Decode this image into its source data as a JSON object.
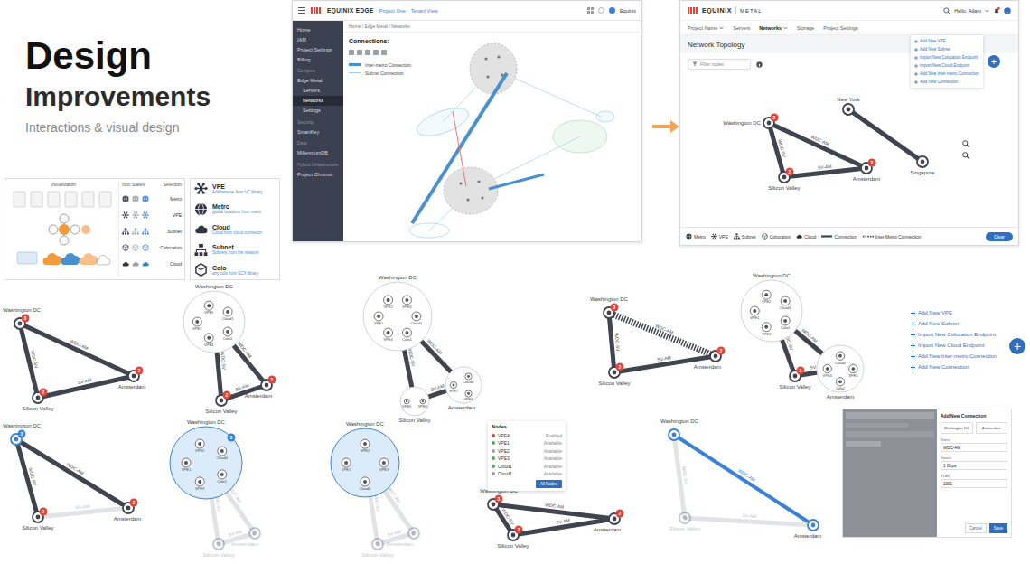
{
  "heading": {
    "title": "Design",
    "subtitle": "Improvements",
    "tagline": "Interactions & visual design"
  },
  "icon_sheet": {
    "columns": [
      "Visualization",
      "Icon States",
      "Selection"
    ],
    "rows": [
      {
        "label": "Metro",
        "kind": "metro"
      },
      {
        "label": "VPE",
        "kind": "vpe"
      },
      {
        "label": "Subnet",
        "kind": "subnet"
      },
      {
        "label": "Colocation",
        "kind": "colo"
      },
      {
        "label": "Cloud",
        "kind": "cloud"
      }
    ]
  },
  "legend_card": {
    "items": [
      {
        "name": "VPE",
        "desc": "Add/remove from VC library",
        "kind": "vpe"
      },
      {
        "name": "Metro",
        "desc": "global locations from metro",
        "kind": "metro"
      },
      {
        "name": "Cloud",
        "desc": "Cloud from cloud connector",
        "kind": "cloud"
      },
      {
        "name": "Subnet",
        "desc": "Subnets from the network",
        "kind": "subnet"
      },
      {
        "name": "Colo",
        "desc": "any colo from ECX library",
        "kind": "colo"
      }
    ]
  },
  "old_ui": {
    "logo": "EQUINIX EDGE",
    "project": "Project One",
    "view": "Tenant View",
    "user": "Equinix",
    "breadcrumb": "Home / Edge Metal / Networks",
    "heading": "Connections:",
    "legend": [
      {
        "label": "Inter-metro Connection",
        "kind": "inter-bar"
      },
      {
        "label": "Subnet Connection",
        "kind": "subnet-line"
      }
    ],
    "sidebar": [
      {
        "label": "Home",
        "kind": "item",
        "selected": false
      },
      {
        "label": "IAM",
        "kind": "item",
        "selected": false
      },
      {
        "label": "Project Settings",
        "kind": "item",
        "selected": false
      },
      {
        "label": "Billing",
        "kind": "item",
        "selected": false
      },
      {
        "label": "Compute",
        "kind": "section",
        "selected": false
      },
      {
        "label": "Edge Metal",
        "kind": "item",
        "selected": false
      },
      {
        "label": "Servers",
        "kind": "sub",
        "selected": false
      },
      {
        "label": "Networks",
        "kind": "sub",
        "selected": true
      },
      {
        "label": "Settings",
        "kind": "sub",
        "selected": false
      },
      {
        "label": "Security",
        "kind": "section",
        "selected": false
      },
      {
        "label": "SmartKey",
        "kind": "item",
        "selected": false
      },
      {
        "label": "Data",
        "kind": "section",
        "selected": false
      },
      {
        "label": "MillenniumDB",
        "kind": "item",
        "selected": false
      },
      {
        "label": "Hybrid Infrastructure",
        "kind": "section",
        "selected": false
      },
      {
        "label": "Project Chronos",
        "kind": "item",
        "selected": false
      }
    ]
  },
  "new_ui": {
    "logo": "EQUINIX",
    "product": "METAL",
    "user": "Hello, Adam",
    "tabs": [
      {
        "label": "Project Name",
        "selected": false,
        "dropdown": true
      },
      {
        "label": "Servers",
        "selected": false,
        "dropdown": false
      },
      {
        "label": "Networks",
        "selected": true,
        "dropdown": true
      },
      {
        "label": "Storage",
        "selected": false,
        "dropdown": false
      },
      {
        "label": "Project Settings",
        "selected": false,
        "dropdown": false
      }
    ],
    "title": "Network Topology",
    "filter_placeholder": "Filter nodes",
    "menu": [
      "Add New VPE",
      "Add New Subnet",
      "Import New Colocation Endpoint",
      "Import New Cloud Endpoint",
      "Add New Inter-metro Connection",
      "Add New Connection"
    ],
    "menu_button": "+",
    "metros": [
      {
        "label": "Washington DC",
        "badge": "3"
      },
      {
        "label": "Silicon Valley",
        "badge": "2"
      },
      {
        "label": "Amsterdam",
        "badge": "2"
      },
      {
        "label": "New York",
        "badge": ""
      },
      {
        "label": "Singapore",
        "badge": ""
      }
    ],
    "edges": [
      {
        "from": 0,
        "to": 2,
        "label": "WDC-AM"
      },
      {
        "from": 0,
        "to": 1,
        "label": "WDC-SV"
      },
      {
        "from": 1,
        "to": 2,
        "label": "SV-AM"
      },
      {
        "from": 3,
        "to": 4,
        "label": ""
      }
    ],
    "legend": [
      {
        "label": "Metro",
        "kind": "metro"
      },
      {
        "label": "VPE",
        "kind": "vpe"
      },
      {
        "label": "Subnet",
        "kind": "subnet"
      },
      {
        "label": "Colocation",
        "kind": "colo"
      },
      {
        "label": "Cloud",
        "kind": "cloud"
      },
      {
        "label": "Connection",
        "kind": "connection"
      },
      {
        "label": "Inter Metro Connection",
        "kind": "inter"
      }
    ],
    "clear": "Clear"
  },
  "variants": [
    {
      "metros": [
        {
          "label": "Washington DC",
          "badge": "3",
          "state": "normal",
          "selected": false,
          "members": []
        },
        {
          "label": "Silicon Valley",
          "badge": "2",
          "state": "normal",
          "selected": false,
          "members": []
        },
        {
          "label": "Amsterdam",
          "badge": "2",
          "state": "normal",
          "selected": false,
          "members": []
        }
      ],
      "edges": [
        {
          "from": 0,
          "to": 2,
          "label": "WDC-AM",
          "state": "normal"
        },
        {
          "from": 0,
          "to": 1,
          "label": "WDC-SV",
          "state": "normal"
        },
        {
          "from": 1,
          "to": 2,
          "label": "SV-AM",
          "state": "normal"
        }
      ]
    },
    {
      "metros": [
        {
          "label": "Washington DC",
          "badge": "",
          "state": "expanded",
          "selected": false,
          "members": [
            "VPE1",
            "VPE2",
            "Cloud1",
            "Colo1",
            "VPE3"
          ]
        },
        {
          "label": "Silicon Valley",
          "badge": "2",
          "state": "normal",
          "selected": false,
          "members": []
        },
        {
          "label": "Amsterdam",
          "badge": "1",
          "state": "normal",
          "selected": false,
          "members": []
        }
      ],
      "edges": [
        {
          "from": 0,
          "to": 2,
          "label": "WDC-AM",
          "state": "normal"
        },
        {
          "from": 0,
          "to": 1,
          "label": "WDC-SV",
          "state": "normal"
        },
        {
          "from": 1,
          "to": 2,
          "label": "SV-AM",
          "state": "normal"
        }
      ]
    },
    {
      "metros": [
        {
          "label": "Washington DC",
          "badge": "",
          "state": "expanded",
          "selected": false,
          "members": [
            "VPE1",
            "VPE2",
            "VPE3",
            "Cloud1",
            "Colo1",
            "VPE4"
          ]
        },
        {
          "label": "Silicon Valley",
          "badge": "",
          "state": "expanded",
          "selected": false,
          "members": [
            "VPE5",
            "VPE6"
          ]
        },
        {
          "label": "Amsterdam",
          "badge": "",
          "state": "expanded",
          "selected": false,
          "members": [
            "VPE7",
            "Cloud2",
            "VPE8"
          ]
        }
      ],
      "edges": [
        {
          "from": 0,
          "to": 2,
          "label": "WDC-AM",
          "state": "normal"
        },
        {
          "from": 0,
          "to": 1,
          "label": "WDC-SV",
          "state": "normal"
        },
        {
          "from": 1,
          "to": 2,
          "label": "SV-AM",
          "state": "normal"
        }
      ]
    },
    {
      "metros": [
        {
          "label": "Washington DC",
          "badge": "3",
          "state": "normal",
          "selected": false,
          "members": []
        },
        {
          "label": "Silicon Valley",
          "badge": "2",
          "state": "normal",
          "selected": false,
          "members": []
        },
        {
          "label": "Amsterdam",
          "badge": "2",
          "state": "normal",
          "selected": false,
          "members": []
        }
      ],
      "edges": [
        {
          "from": 0,
          "to": 2,
          "label": "WDC-AM",
          "state": "dashed"
        },
        {
          "from": 0,
          "to": 1,
          "label": "WDC-SV",
          "state": "normal"
        },
        {
          "from": 1,
          "to": 2,
          "label": "SV-AM",
          "state": "normal"
        }
      ]
    },
    {
      "metros": [
        {
          "label": "Washington DC",
          "badge": "",
          "state": "expanded",
          "selected": false,
          "members": [
            "VPE1",
            "VPE2",
            "Cloud1",
            "Colo1",
            "VPE3"
          ]
        },
        {
          "label": "Silicon Valley",
          "badge": "2",
          "state": "normal",
          "selected": false,
          "members": []
        },
        {
          "label": "Amsterdam",
          "badge": "",
          "state": "expanded",
          "selected": false,
          "members": [
            "VPE4",
            "Cloud2",
            "VPE5",
            "Colo2"
          ]
        }
      ],
      "edges": [
        {
          "from": 0,
          "to": 2,
          "label": "WDC-AM",
          "state": "normal"
        },
        {
          "from": 0,
          "to": 1,
          "label": "WDC-SV",
          "state": "normal"
        },
        {
          "from": 1,
          "to": 2,
          "label": "SV-AM",
          "state": "normal"
        }
      ]
    },
    {
      "metros": [
        {
          "label": "Washington DC",
          "badge": "3",
          "state": "normal",
          "selected": true,
          "members": []
        },
        {
          "label": "Silicon Valley",
          "badge": "2",
          "state": "normal",
          "selected": false,
          "members": []
        },
        {
          "label": "Amsterdam",
          "badge": "2",
          "state": "normal",
          "selected": false,
          "members": []
        }
      ],
      "edges": [
        {
          "from": 0,
          "to": 2,
          "label": "WDC-AM",
          "state": "normal"
        },
        {
          "from": 0,
          "to": 1,
          "label": "WDC-SV",
          "state": "normal"
        },
        {
          "from": 1,
          "to": 2,
          "label": "SV-AM",
          "state": "faded"
        }
      ]
    },
    {
      "metros": [
        {
          "label": "Washington DC",
          "badge": "3",
          "state": "expanded",
          "selected": true,
          "members": [
            "VPE1",
            "VPE2",
            "Cloud1",
            "Colo1",
            "VPE3"
          ]
        },
        {
          "label": "Silicon Valley",
          "badge": "",
          "state": "faded",
          "selected": false,
          "members": []
        },
        {
          "label": "Amsterdam",
          "badge": "",
          "state": "faded",
          "selected": false,
          "members": []
        }
      ],
      "edges": [
        {
          "from": 0,
          "to": 2,
          "label": "WDC-AM",
          "state": "faded"
        },
        {
          "from": 0,
          "to": 1,
          "label": "WDC-SV",
          "state": "faded"
        },
        {
          "from": 1,
          "to": 2,
          "label": "SV-AM",
          "state": "faded"
        }
      ]
    },
    {
      "metros": [
        {
          "label": "Washington DC",
          "badge": "",
          "state": "expanded",
          "selected": true,
          "members": [
            "VPE1",
            "VPE2",
            "VPE3",
            "Cloud1"
          ]
        },
        {
          "label": "Silicon Valley",
          "badge": "",
          "state": "faded",
          "selected": false,
          "members": []
        },
        {
          "label": "Amsterdam",
          "badge": "",
          "state": "faded",
          "selected": false,
          "members": []
        }
      ],
      "edges": [
        {
          "from": 0,
          "to": 2,
          "label": "WDC-AM",
          "state": "faded"
        },
        {
          "from": 0,
          "to": 1,
          "label": "WDC-SV",
          "state": "faded"
        },
        {
          "from": 1,
          "to": 2,
          "label": "SV-AM",
          "state": "faded"
        }
      ]
    },
    {
      "metros": [
        {
          "label": "Washington DC",
          "badge": "3",
          "state": "normal",
          "selected": false,
          "members": []
        },
        {
          "label": "Silicon Valley",
          "badge": "2",
          "state": "normal",
          "selected": false,
          "members": []
        },
        {
          "label": "Amsterdam",
          "badge": "2",
          "state": "normal",
          "selected": false,
          "members": []
        }
      ],
      "edges": [
        {
          "from": 0,
          "to": 2,
          "label": "WDC-AM",
          "state": "normal"
        },
        {
          "from": 0,
          "to": 1,
          "label": "WDC-SV",
          "state": "normal"
        },
        {
          "from": 1,
          "to": 2,
          "label": "SV-AM",
          "state": "normal"
        }
      ],
      "popover": {
        "title": "Nodes",
        "rows": [
          {
            "name": "VPE4",
            "status": "Enabled",
            "color": "#e0453a"
          },
          {
            "name": "VPE1",
            "status": "Available",
            "color": "#4caf50"
          },
          {
            "name": "VPE2",
            "status": "Available",
            "color": "#9e9e9e"
          },
          {
            "name": "VPE3",
            "status": "Available",
            "color": "#4caf50"
          },
          {
            "name": "Cloud1",
            "status": "Available",
            "color": "#4caf50"
          },
          {
            "name": "Cloud1",
            "status": "Available",
            "color": "#9e9e9e"
          }
        ],
        "button": "All Nodes"
      }
    },
    {
      "metros": [
        {
          "label": "Washington DC",
          "badge": "",
          "state": "normal",
          "selected": true,
          "members": []
        },
        {
          "label": "Silicon Valley",
          "badge": "",
          "state": "faded",
          "selected": false,
          "members": []
        },
        {
          "label": "Amsterdam",
          "badge": "",
          "state": "normal",
          "selected": true,
          "members": []
        }
      ],
      "edges": [
        {
          "from": 0,
          "to": 2,
          "label": "WDC-AM",
          "state": "highlight"
        },
        {
          "from": 0,
          "to": 1,
          "label": "WDC-SV",
          "state": "faded"
        },
        {
          "from": 1,
          "to": 2,
          "label": "SV-AM",
          "state": "faded"
        }
      ]
    }
  ],
  "add_menu": {
    "items": [
      "Add New VPE",
      "Add New Subnet",
      "Import New Colocation Endpoint",
      "Import New Cloud Endpoint",
      "Add New Inter-metro Connection",
      "Add New Connection"
    ],
    "button": "+"
  },
  "add_connection": {
    "title": "Add New Connection",
    "endpoints": [
      "Washington DC",
      "Amsterdam"
    ],
    "fields": [
      {
        "label": "Name",
        "value": "WDC-AM"
      },
      {
        "label": "Speed",
        "value": "1 Gbps"
      },
      {
        "label": "VLAN",
        "value": "1001"
      }
    ],
    "buttons": [
      {
        "label": "Cancel",
        "primary": false
      },
      {
        "label": "Save",
        "primary": true
      }
    ]
  }
}
